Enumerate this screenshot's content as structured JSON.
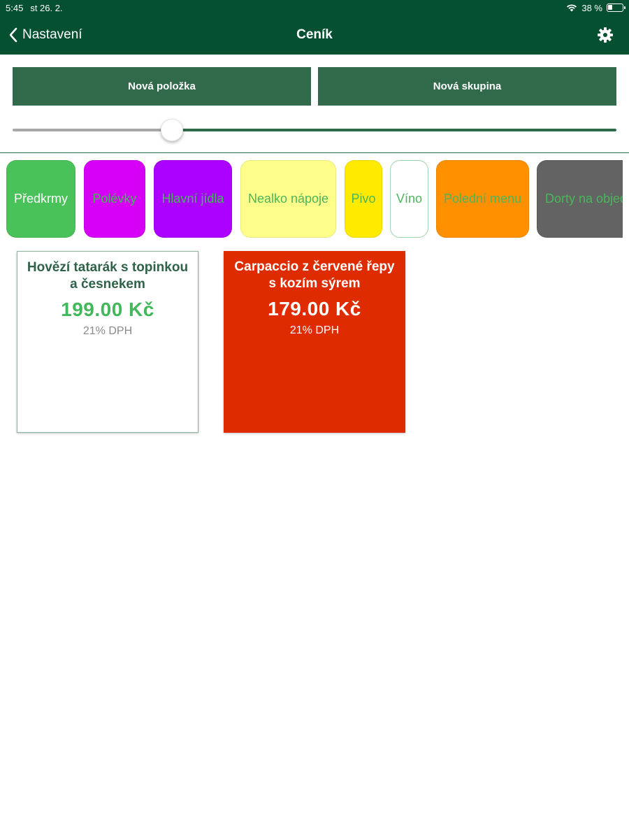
{
  "status_bar": {
    "time": "5:45",
    "date": "st 26. 2.",
    "battery": "38 %",
    "icons": [
      "wifi-icon",
      "battery-icon"
    ]
  },
  "nav": {
    "back_label": "Nastavení",
    "title": "Ceník",
    "settings_icon": "gear-icon"
  },
  "actions": {
    "new_item": "Nová položka",
    "new_group": "Nová skupina"
  },
  "slider": {
    "value": 0.26
  },
  "categories": [
    {
      "label": "Předkrmy",
      "bg": "#4ac25a",
      "fg": "#ffffff"
    },
    {
      "label": "Polévky",
      "bg": "#d600f6",
      "fg": "#4ab65c"
    },
    {
      "label": "Hlavní jídla",
      "bg": "#ab00ff",
      "fg": "#4ab65c"
    },
    {
      "label": "Nealko nápoje",
      "bg": "#fdfe8a",
      "fg": "#4ab65c"
    },
    {
      "label": "Pivo",
      "bg": "#ffea00",
      "fg": "#4ab65c"
    },
    {
      "label": "Víno",
      "bg": "#ffffff",
      "fg": "#4ab65c"
    },
    {
      "label": "Polední menu",
      "bg": "#ff9100",
      "fg": "#4ab65c"
    },
    {
      "label": "Dorty na objednávku",
      "bg": "#636363",
      "fg": "#4ab65c"
    }
  ],
  "items": [
    {
      "name": "Hovězí tatarák s topinkou a česnekem",
      "price": "199.00 Kč",
      "vat": "21% DPH",
      "bg": "#ffffff"
    },
    {
      "name": "Carpaccio z červené řepy s kozím sýrem",
      "price": "179.00 Kč",
      "vat": "21% DPH",
      "bg": "#df2b00"
    }
  ],
  "colors": {
    "header": "#055030",
    "accent": "#306a4a"
  }
}
